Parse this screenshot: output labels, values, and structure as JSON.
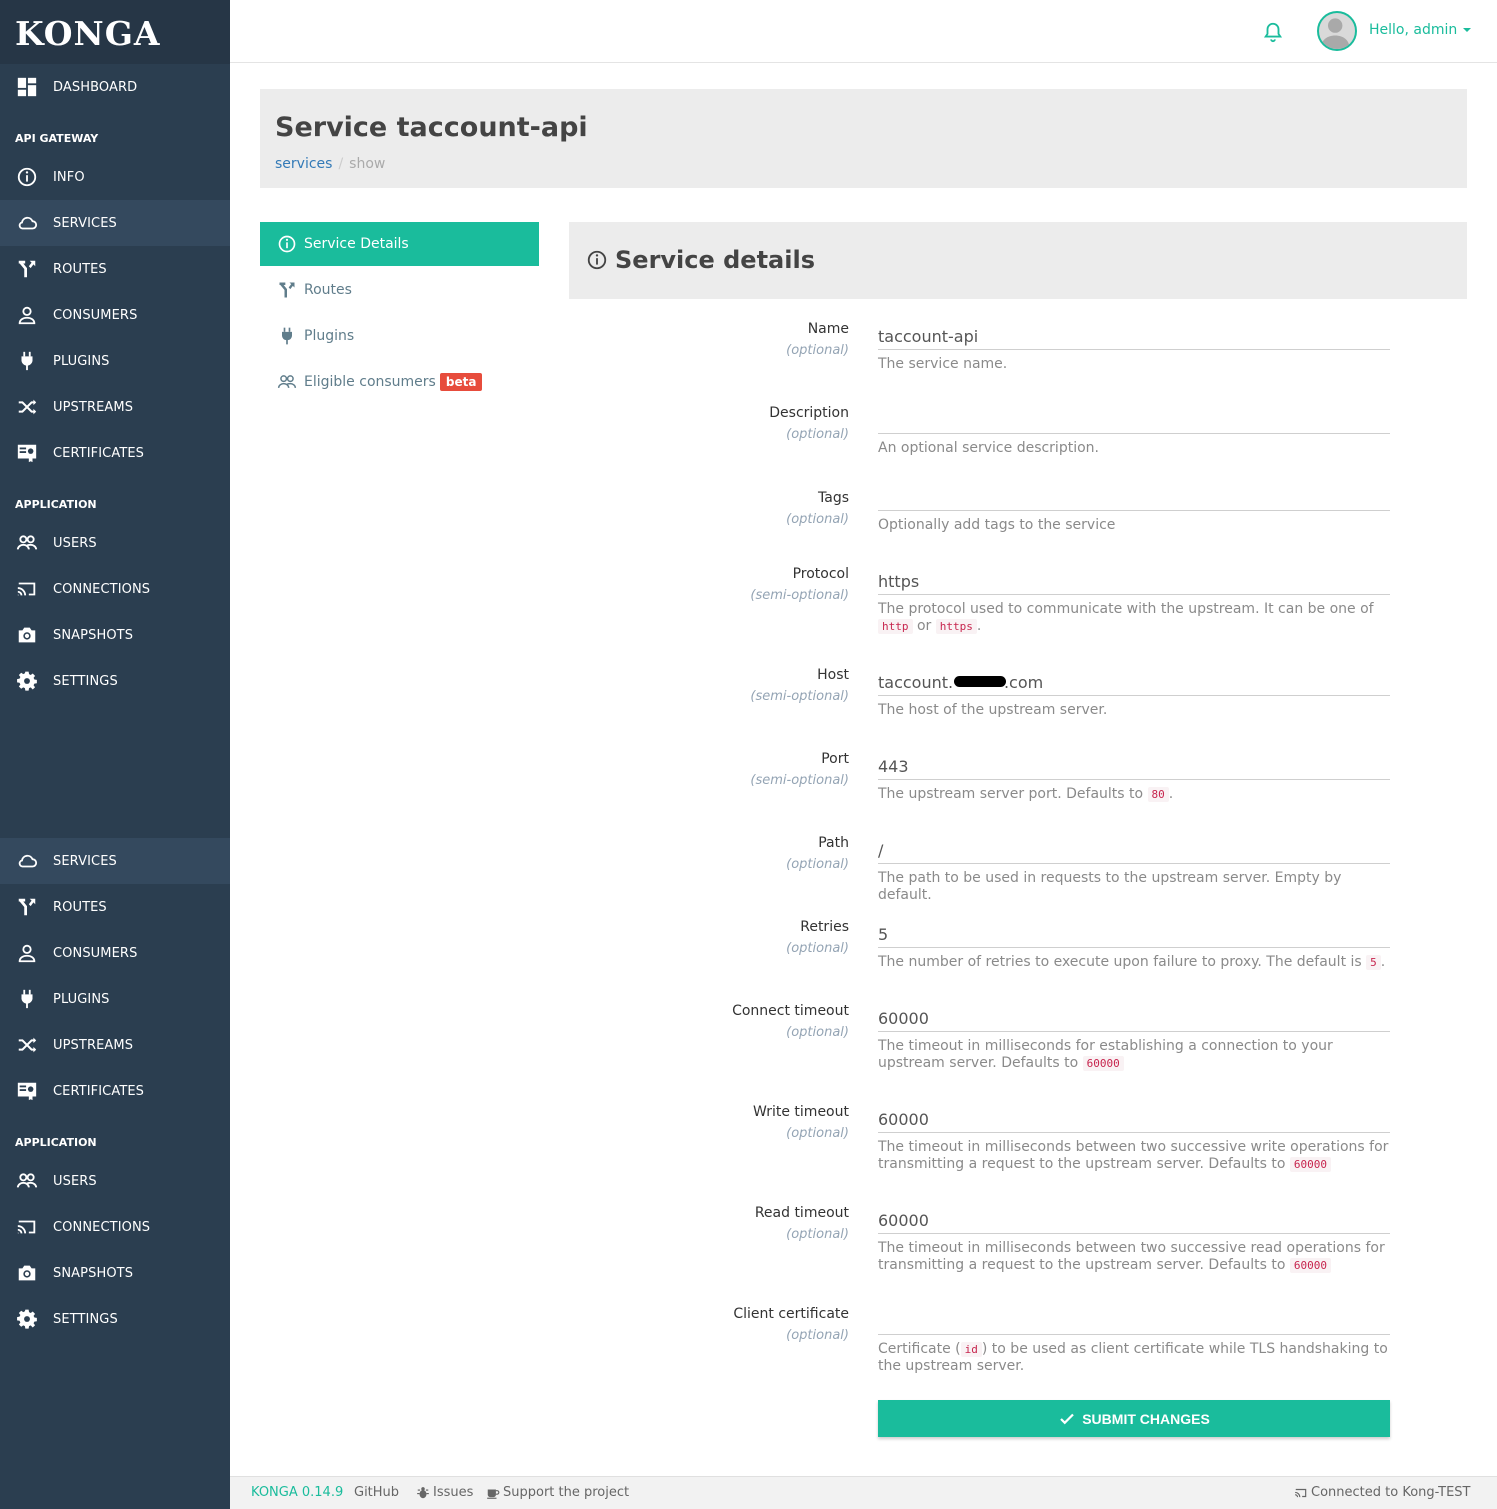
{
  "app": {
    "logo": "KONGA"
  },
  "sidebar": {
    "groups": [
      {
        "items": [
          {
            "label": "DASHBOARD",
            "icon": "dashboard-icon"
          }
        ]
      },
      {
        "section": "API GATEWAY",
        "items": [
          {
            "label": "INFO",
            "icon": "info-icon"
          },
          {
            "label": "SERVICES",
            "icon": "cloud-icon",
            "active": true
          },
          {
            "label": "ROUTES",
            "icon": "routes-icon"
          },
          {
            "label": "CONSUMERS",
            "icon": "user-icon"
          },
          {
            "label": "PLUGINS",
            "icon": "plug-icon"
          },
          {
            "label": "UPSTREAMS",
            "icon": "shuffle-icon"
          },
          {
            "label": "CERTIFICATES",
            "icon": "certificate-icon"
          }
        ]
      },
      {
        "section": "APPLICATION",
        "items": [
          {
            "label": "USERS",
            "icon": "users-icon"
          },
          {
            "label": "CONNECTIONS",
            "icon": "cast-icon"
          },
          {
            "label": "SNAPSHOTS",
            "icon": "camera-icon"
          },
          {
            "label": "SETTINGS",
            "icon": "gear-icon"
          }
        ]
      }
    ],
    "repeat": {
      "api_items": [
        {
          "label": "SERVICES",
          "icon": "cloud-icon",
          "active": true
        },
        {
          "label": "ROUTES",
          "icon": "routes-icon"
        },
        {
          "label": "CONSUMERS",
          "icon": "user-icon"
        },
        {
          "label": "PLUGINS",
          "icon": "plug-icon"
        },
        {
          "label": "UPSTREAMS",
          "icon": "shuffle-icon"
        },
        {
          "label": "CERTIFICATES",
          "icon": "certificate-icon"
        }
      ],
      "section": "APPLICATION",
      "app_items": [
        {
          "label": "USERS",
          "icon": "users-icon"
        },
        {
          "label": "CONNECTIONS",
          "icon": "cast-icon"
        },
        {
          "label": "SNAPSHOTS",
          "icon": "camera-icon"
        },
        {
          "label": "SETTINGS",
          "icon": "gear-icon"
        }
      ]
    }
  },
  "header": {
    "user_greeting": "Hello, admin",
    "notification_icon": "bell-icon"
  },
  "page": {
    "title": "Service taccount-api",
    "breadcrumb": {
      "link": "services",
      "separator": "/",
      "current": "show"
    }
  },
  "tabs": [
    {
      "label": "Service Details",
      "icon": "info-icon",
      "active": true
    },
    {
      "label": "Routes",
      "icon": "routes-icon"
    },
    {
      "label": "Plugins",
      "icon": "plug-icon"
    },
    {
      "label": "Eligible consumers",
      "icon": "users-icon",
      "badge": "beta"
    }
  ],
  "panel": {
    "title": "Service details"
  },
  "form": {
    "fields": [
      {
        "label": "Name",
        "sub": "(optional)",
        "value": "taccount-api",
        "help": "The service name."
      },
      {
        "label": "Description",
        "sub": "(optional)",
        "value": "",
        "help": "An optional service description."
      },
      {
        "label": "Tags",
        "sub": "(optional)",
        "value": "",
        "help": "Optionally add tags to the service"
      },
      {
        "label": "Protocol",
        "sub": "(semi-optional)",
        "value": "https",
        "help": "The protocol used to communicate with the upstream. It can be one of",
        "code1": "http",
        "mid": "or",
        "code2": "https",
        "tail": "."
      },
      {
        "label": "Host",
        "sub": "(semi-optional)",
        "value": "taccount.          .com",
        "help": "The host of the upstream server."
      },
      {
        "label": "Port",
        "sub": "(semi-optional)",
        "value": "443",
        "help": "The upstream server port. Defaults to",
        "code1": "80",
        "tail": "."
      },
      {
        "label": "Path",
        "sub": "(optional)",
        "value": "/",
        "help": "The path to be used in requests to the upstream server. Empty by default."
      },
      {
        "label": "Retries",
        "sub": "(optional)",
        "value": "5",
        "help": "The number of retries to execute upon failure to proxy. The default is",
        "code1": "5",
        "tail": "."
      },
      {
        "label": "Connect timeout",
        "sub": "(optional)",
        "value": "60000",
        "help": "The timeout in milliseconds for establishing a connection to your upstream server. Defaults to",
        "code1": "60000"
      },
      {
        "label": "Write timeout",
        "sub": "(optional)",
        "value": "60000",
        "help": "The timeout in milliseconds between two successive write operations for transmitting a request to the upstream server. Defaults to",
        "code1": "60000"
      },
      {
        "label": "Read timeout",
        "sub": "(optional)",
        "value": "60000",
        "help": "The timeout in milliseconds between two successive read operations for transmitting a request to the upstream server. Defaults to",
        "code1": "60000"
      },
      {
        "label": "Client certificate",
        "sub": "(optional)",
        "value": "",
        "help_pre": "Certificate (",
        "code1": "id",
        "help": ") to be used as client certificate while TLS handshaking to the upstream server."
      }
    ],
    "submit_label": "SUBMIT CHANGES"
  },
  "footer": {
    "version": "KONGA 0.14.9",
    "github": "GitHub",
    "issues": "Issues",
    "support": "Support the project",
    "connection_prefix": "Connected to",
    "connection_name": "Kong-TEST"
  },
  "colors": {
    "accent": "#1abc9c",
    "sidebar": "#2b3e50",
    "sidebar_active": "#34495e",
    "badge": "#e74c3c"
  }
}
